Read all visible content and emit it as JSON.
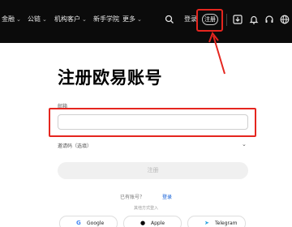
{
  "nav": {
    "items": [
      {
        "label": "金融",
        "has_dropdown": true
      },
      {
        "label": "公链",
        "has_dropdown": true
      },
      {
        "label": "机构客户",
        "has_dropdown": true
      },
      {
        "label": "新手学院",
        "has_dropdown": false
      },
      {
        "label": "更多",
        "has_dropdown": true
      }
    ],
    "login_label": "登录",
    "signup_label": "注册",
    "icons": [
      "search-icon",
      "download-icon",
      "bell-icon",
      "headset-icon",
      "globe-icon"
    ]
  },
  "form": {
    "title": "注册欧易账号",
    "email_label": "邮箱",
    "email_value": "",
    "invite_label": "邀请码（选填）",
    "submit_label": "注册",
    "have_account_text": "已有账号？",
    "login_link": "登录",
    "other_methods_text": "其他方式登入"
  },
  "social": [
    {
      "label": "Google",
      "icon": "google-icon"
    },
    {
      "label": "Apple",
      "icon": "apple-icon"
    },
    {
      "label": "Telegram",
      "icon": "telegram-icon"
    }
  ],
  "annotation": {
    "highlight_color": "#e5261f"
  }
}
